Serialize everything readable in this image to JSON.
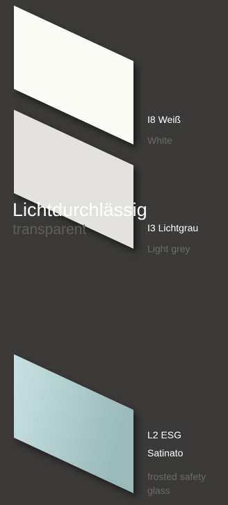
{
  "swatches": [
    {
      "code_name": "I8 Weiß",
      "english": "White",
      "color": "#fbfbf5"
    },
    {
      "code_name": "I3 Lichtgrau",
      "english": "Light grey",
      "color": "#e4e2de"
    }
  ],
  "section": {
    "title": "Lichtdurchlässig",
    "subtitle": "transparent"
  },
  "glass": {
    "code": "L2 ESG",
    "name": "Satinato",
    "english": "frosted safety glass",
    "color_light": "#c9e0e2",
    "color_dark": "#9ab9b9"
  },
  "colors": {
    "background": "#3b3a38",
    "text_primary": "#ffffff",
    "text_secondary": "#6a6967"
  }
}
